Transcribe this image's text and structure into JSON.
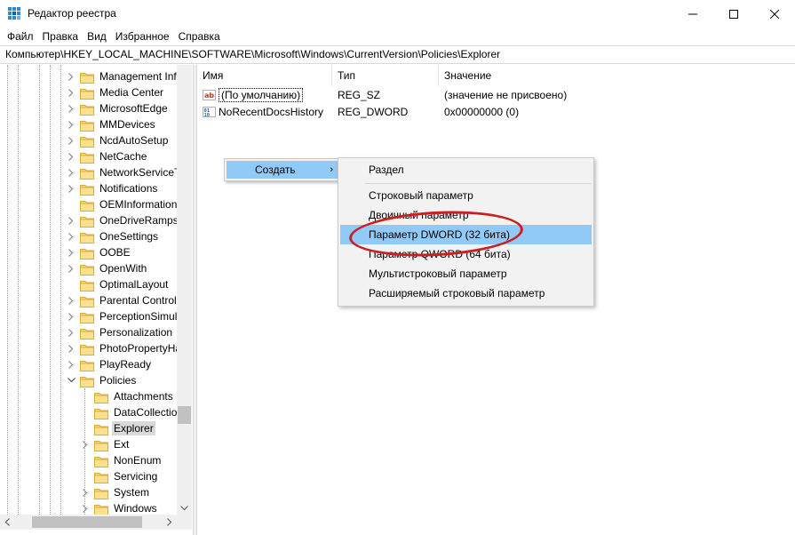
{
  "window": {
    "title": "Редактор реестра"
  },
  "menu": [
    "Файл",
    "Правка",
    "Вид",
    "Избранное",
    "Справка"
  ],
  "address": "Компьютер\\HKEY_LOCAL_MACHINE\\SOFTWARE\\Microsoft\\Windows\\CurrentVersion\\Policies\\Explorer",
  "tree": {
    "items": [
      {
        "label": "Management Infr",
        "expandable": true,
        "level": 0
      },
      {
        "label": "Media Center",
        "expandable": true,
        "level": 0
      },
      {
        "label": "MicrosoftEdge",
        "expandable": true,
        "level": 0
      },
      {
        "label": "MMDevices",
        "expandable": true,
        "level": 0
      },
      {
        "label": "NcdAutoSetup",
        "expandable": true,
        "level": 0
      },
      {
        "label": "NetCache",
        "expandable": true,
        "level": 0
      },
      {
        "label": "NetworkServiceTr",
        "expandable": true,
        "level": 0
      },
      {
        "label": "Notifications",
        "expandable": true,
        "level": 0
      },
      {
        "label": "OEMInformation",
        "expandable": false,
        "level": 0
      },
      {
        "label": "OneDriveRamps",
        "expandable": true,
        "level": 0
      },
      {
        "label": "OneSettings",
        "expandable": true,
        "level": 0
      },
      {
        "label": "OOBE",
        "expandable": true,
        "level": 0
      },
      {
        "label": "OpenWith",
        "expandable": true,
        "level": 0
      },
      {
        "label": "OptimalLayout",
        "expandable": false,
        "level": 0
      },
      {
        "label": "Parental Controls",
        "expandable": true,
        "level": 0
      },
      {
        "label": "PerceptionSimula",
        "expandable": true,
        "level": 0
      },
      {
        "label": "Personalization",
        "expandable": true,
        "level": 0
      },
      {
        "label": "PhotoPropertyHa",
        "expandable": true,
        "level": 0
      },
      {
        "label": "PlayReady",
        "expandable": true,
        "level": 0
      },
      {
        "label": "Policies",
        "expandable": true,
        "expanded": true,
        "level": 0
      },
      {
        "label": "Attachments",
        "expandable": false,
        "level": 1
      },
      {
        "label": "DataCollection",
        "expandable": false,
        "level": 1
      },
      {
        "label": "Explorer",
        "expandable": false,
        "level": 1,
        "selected": true
      },
      {
        "label": "Ext",
        "expandable": true,
        "level": 1
      },
      {
        "label": "NonEnum",
        "expandable": false,
        "level": 1
      },
      {
        "label": "Servicing",
        "expandable": false,
        "level": 1
      },
      {
        "label": "System",
        "expandable": true,
        "level": 1
      },
      {
        "label": "Windows",
        "expandable": true,
        "level": 1
      }
    ]
  },
  "list": {
    "columns": [
      "Имя",
      "Тип",
      "Значение"
    ],
    "rows": [
      {
        "name": "(По умолчанию)",
        "type": "REG_SZ",
        "value": "(значение не присвоено)",
        "icon": "string-value-icon"
      },
      {
        "name": "NoRecentDocsHistory",
        "type": "REG_DWORD",
        "value": "0x00000000 (0)",
        "icon": "binary-value-icon"
      }
    ]
  },
  "context_menu": {
    "parent_label": "Создать",
    "items": [
      {
        "label": "Раздел"
      },
      {
        "label": "Строковый параметр"
      },
      {
        "label": "Двоичный параметр"
      },
      {
        "label": "Параметр DWORD (32 бита)",
        "highlighted": true
      },
      {
        "label": "Параметр QWORD (64 бита)"
      },
      {
        "label": "Мультистроковый параметр"
      },
      {
        "label": "Расширяемый строковый параметр"
      }
    ]
  },
  "colors": {
    "menu_highlight": "#91c9f7",
    "annotation": "#cc1f1f",
    "folder": "#f8d775"
  }
}
